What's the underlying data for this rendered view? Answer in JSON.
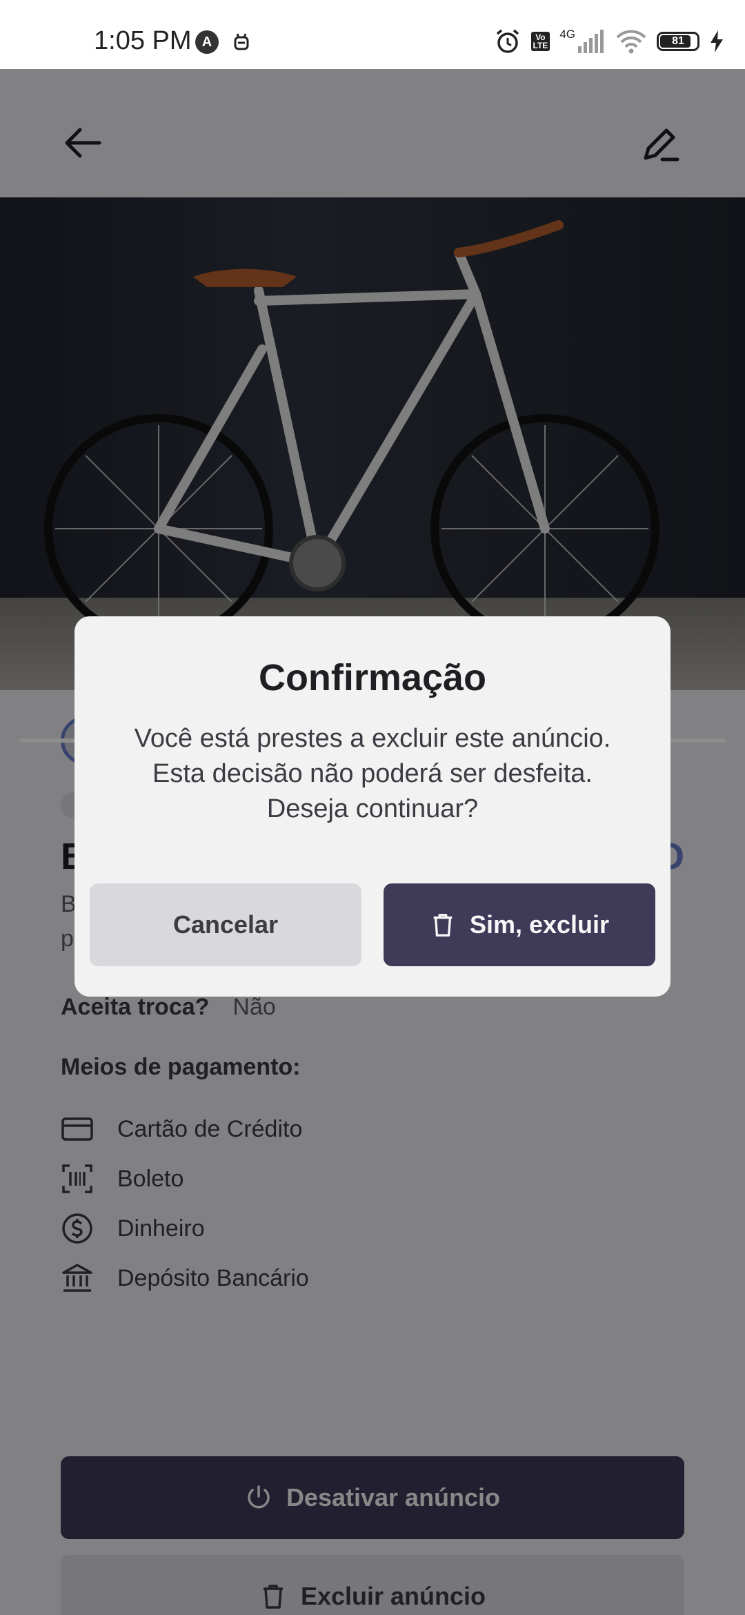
{
  "status_bar": {
    "time": "1:05 PM",
    "network": "4G",
    "battery": "81"
  },
  "listing": {
    "title_initial": "B",
    "price_partial": "O",
    "description_initials": [
      "B",
      "p"
    ],
    "trade_label": "Aceita troca?",
    "trade_value": "Não",
    "payment_header": "Meios de pagamento:",
    "payments": [
      {
        "icon": "credit-card-icon",
        "label": "Cartão de Crédito"
      },
      {
        "icon": "barcode-icon",
        "label": "Boleto"
      },
      {
        "icon": "money-icon",
        "label": "Dinheiro"
      },
      {
        "icon": "bank-icon",
        "label": "Depósito Bancário"
      }
    ],
    "deactivate_label": "Desativar anúncio",
    "delete_label": "Excluir anúncio"
  },
  "modal": {
    "title": "Confirmação",
    "message_lines": [
      "Você está prestes a excluir este anúncio.",
      "Esta decisão não poderá ser desfeita.",
      "Deseja continuar?"
    ],
    "cancel_label": "Cancelar",
    "confirm_label": "Sim, excluir"
  },
  "colors": {
    "primary": "#3e3a58",
    "accent": "#647ac7",
    "background": "#ececf1",
    "modal_bg": "#f2f2f2"
  }
}
